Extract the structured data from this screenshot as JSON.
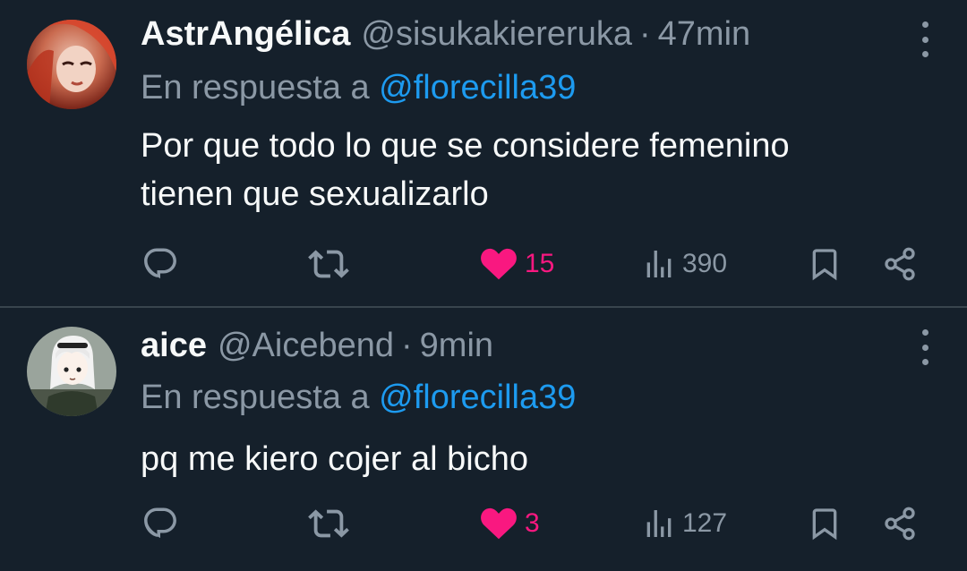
{
  "tweets": [
    {
      "author_name": "AstrAngélica",
      "handle": "@sisukakiereruka",
      "separator": "·",
      "time": "47min",
      "reply_prefix": "En respuesta a",
      "reply_mention": "@florecilla39",
      "text_lines": [
        "Por que todo lo que se considere femenino",
        "tienen que sexualizarlo"
      ],
      "likes": "15",
      "views": "390",
      "liked": true
    },
    {
      "author_name": "aice",
      "handle": "@Aicebend",
      "separator": "·",
      "time": "9min",
      "reply_prefix": "En respuesta a",
      "reply_mention": "@florecilla39",
      "text_lines": [
        "pq me kiero cojer al bicho"
      ],
      "likes": "3",
      "views": "127",
      "liked": true
    }
  ],
  "colors": {
    "background": "#15202b",
    "secondary_text": "#8b98a5",
    "mention": "#1d9bf0",
    "like": "#f91880",
    "divider": "#38444d"
  },
  "icons": [
    "reply-icon",
    "retweet-icon",
    "like-icon",
    "views-icon",
    "bookmark-icon",
    "share-icon",
    "more-icon"
  ]
}
